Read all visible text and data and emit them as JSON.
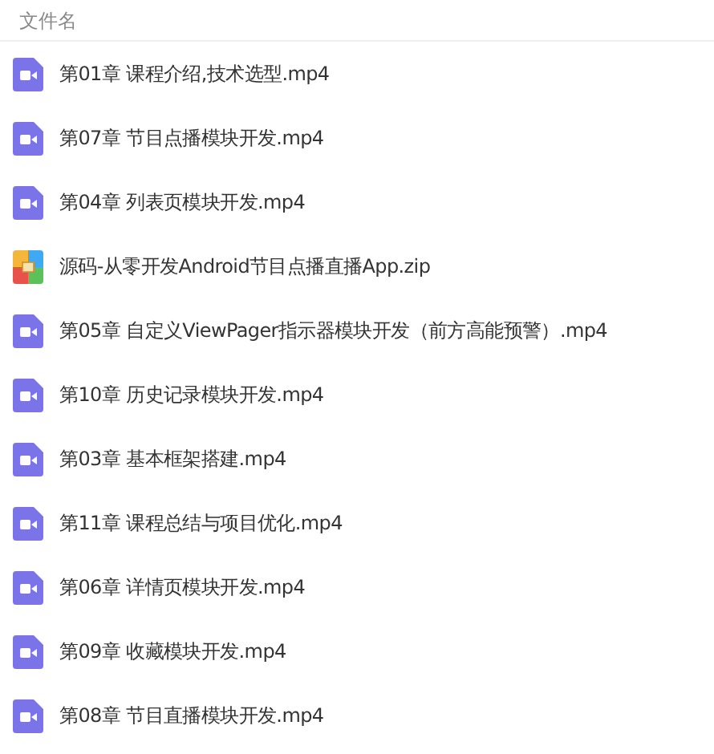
{
  "header": {
    "label": "文件名"
  },
  "files": [
    {
      "name": "第01章 课程介绍,技术选型.mp4",
      "kind": "video"
    },
    {
      "name": "第07章 节目点播模块开发.mp4",
      "kind": "video"
    },
    {
      "name": "第04章 列表页模块开发.mp4",
      "kind": "video"
    },
    {
      "name": "源码-从零开发Android节目点播直播App.zip",
      "kind": "archive"
    },
    {
      "name": "第05章 自定义ViewPager指示器模块开发（前方高能预警）.mp4",
      "kind": "video"
    },
    {
      "name": "第10章 历史记录模块开发.mp4",
      "kind": "video"
    },
    {
      "name": "第03章 基本框架搭建.mp4",
      "kind": "video"
    },
    {
      "name": "第11章 课程总结与项目优化.mp4",
      "kind": "video"
    },
    {
      "name": "第06章 详情页模块开发.mp4",
      "kind": "video"
    },
    {
      "name": "第09章 收藏模块开发.mp4",
      "kind": "video"
    },
    {
      "name": "第08章 节目直播模块开发.mp4",
      "kind": "video"
    }
  ]
}
